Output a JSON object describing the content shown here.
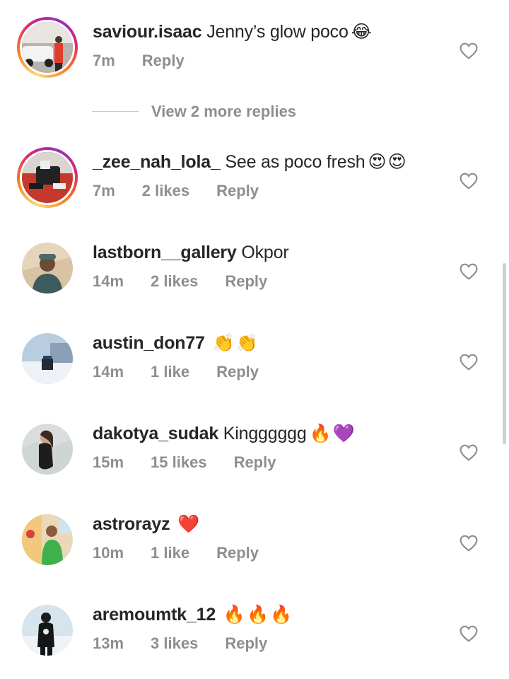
{
  "view_more_replies": "View 2 more replies",
  "comments": [
    {
      "username": "saviour.isaac",
      "text": "Jenny’s glow poco",
      "emoji": "😂",
      "time": "7m",
      "likes": "",
      "reply": "Reply"
    },
    {
      "username": "_zee_nah_lola_",
      "text": "See as poco fresh",
      "emoji": "😍😍",
      "time": "7m",
      "likes": "2 likes",
      "reply": "Reply"
    },
    {
      "username": "lastborn__gallery",
      "text": "Okpor",
      "emoji": "",
      "time": "14m",
      "likes": "2 likes",
      "reply": "Reply"
    },
    {
      "username": "austin_don77",
      "text": "",
      "emoji": "👏👏",
      "time": "14m",
      "likes": "1 like",
      "reply": "Reply"
    },
    {
      "username": "dakotya_sudak",
      "text": "Kingggggg",
      "emoji": "🔥💜",
      "time": "15m",
      "likes": "15 likes",
      "reply": "Reply"
    },
    {
      "username": "astrorayz",
      "text": "",
      "emoji": "❤️",
      "time": "10m",
      "likes": "1 like",
      "reply": "Reply"
    },
    {
      "username": "aremoumtk_12",
      "text": "",
      "emoji": "🔥🔥🔥",
      "time": "13m",
      "likes": "3 likes",
      "reply": "Reply"
    }
  ],
  "colors": {
    "primary_text": "#262626",
    "secondary_text": "#8e8e8e",
    "story_ring": [
      "#feda75",
      "#fa7e1e",
      "#d62976",
      "#962fbf"
    ]
  }
}
